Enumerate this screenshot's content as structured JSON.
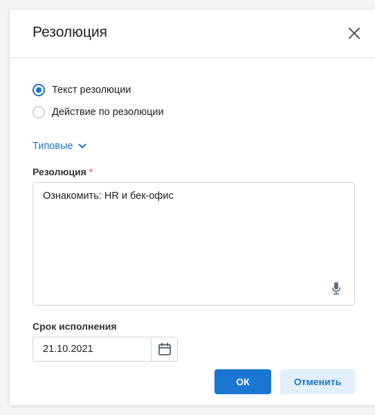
{
  "dialog": {
    "title": "Резолюция",
    "close_icon": "close-icon"
  },
  "resolution_type": {
    "options": [
      {
        "label": "Текст резолюции",
        "selected": true
      },
      {
        "label": "Действие по резолюции",
        "selected": false
      }
    ]
  },
  "typical": {
    "label": "Типовые",
    "icon": "chevron-down-icon"
  },
  "resolution_field": {
    "label": "Резолюция",
    "required_mark": "*",
    "value": "Ознакомить: HR и бек-офис",
    "mic_icon": "microphone-icon"
  },
  "due_date": {
    "label": "Срок исполнения",
    "value": "21.10.2021",
    "calendar_icon": "calendar-icon"
  },
  "buttons": {
    "ok": "ОК",
    "cancel": "Отменить"
  },
  "colors": {
    "accent": "#1976d2",
    "required": "#e53935",
    "cancel_bg": "#e3f0fc"
  }
}
